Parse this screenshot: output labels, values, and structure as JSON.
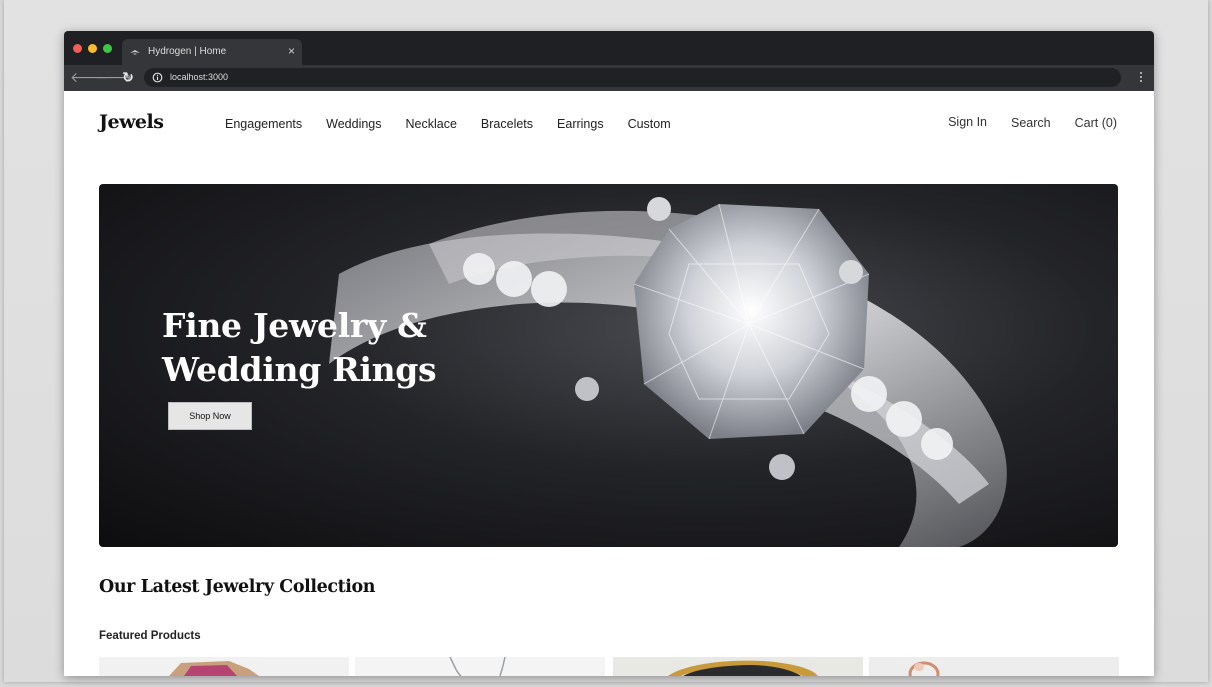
{
  "browser": {
    "tab_title": "Hydrogen | Home",
    "tab_close": "×",
    "url": "localhost:3000",
    "back": "🡐",
    "forward": "🡒",
    "reload": "↻"
  },
  "header": {
    "brand": "Jewels",
    "nav": [
      "Engagements",
      "Weddings",
      "Necklace",
      "Bracelets",
      "Earrings",
      "Custom"
    ],
    "sign_in": "Sign In",
    "search": "Search",
    "cart": "Cart (0)"
  },
  "hero": {
    "title_line1": "Fine Jewelry &",
    "title_line2": "Wedding Rings",
    "cta": "Shop Now"
  },
  "collection": {
    "title": "Our Latest Jewelry Collection",
    "featured_label": "Featured Products"
  },
  "products": [
    {
      "image": "pink-gemstone-ring-image"
    },
    {
      "image": "silver-necklace-image"
    },
    {
      "image": "gold-enamel-band-image"
    },
    {
      "image": "rose-gold-ring-image"
    }
  ],
  "colors": {
    "browser_chrome": "#1f2023",
    "accent_dark": "#111111",
    "button_bg": "#e6e6e6"
  }
}
